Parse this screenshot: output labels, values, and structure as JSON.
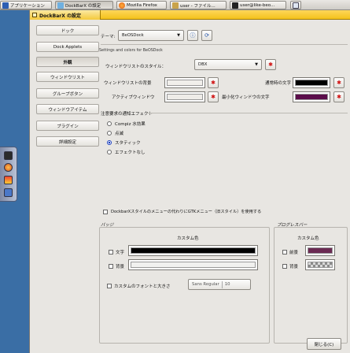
{
  "taskbar": {
    "items": [
      {
        "label": "アプリケーション",
        "icon": "apps-icon"
      },
      {
        "label": "DockBarX の設定",
        "icon": "dockbarx-icon"
      },
      {
        "label": "Mozilla Firefox",
        "icon": "firefox-icon"
      },
      {
        "label": "user - ファイル...",
        "icon": "folder-icon"
      },
      {
        "label": "user@like-beo...",
        "icon": "terminal-icon"
      }
    ]
  },
  "window": {
    "title": "DockBarX の設定"
  },
  "sidebar": {
    "items": [
      {
        "label": "ドック"
      },
      {
        "label": "Dock Applets"
      },
      {
        "label": "外観"
      },
      {
        "label": "ウィンドウリスト"
      },
      {
        "label": "グループボタン"
      },
      {
        "label": "ウィンドウアイテム"
      },
      {
        "label": "プラグイン"
      },
      {
        "label": "詳細設定"
      }
    ],
    "selected_index": 2
  },
  "appearance": {
    "theme_label": "テーマ:",
    "theme_value": "BeOSDock",
    "settings_heading": "Settings and colors for BeOSDock",
    "winlist_style_label": "ウィンドウリストのスタイル：",
    "winlist_style_value": "DBX",
    "winlist_bg_label": "ウィンドウリストの背景",
    "active_window_label": "アクティブウィンドウ",
    "normal_text_label": "通常時の文字",
    "minimized_text_label": "最小化ウィンドウの文字",
    "effect_heading": "注意要求の通知エフェクト",
    "effects": [
      {
        "label": "Compiz 水効果",
        "selected": false
      },
      {
        "label": "点滅",
        "selected": false
      },
      {
        "label": "スタティック",
        "selected": true
      },
      {
        "label": "エフェクトなし",
        "selected": false
      }
    ],
    "gtk_menu_label": "DockbarXスタイルのメニューの代わりにGTKメニュー（旧スタイル）を使用する",
    "gtk_menu_checked": false,
    "badge_heading": "バッジ",
    "badge_custom_color": "カスタム色",
    "badge_text_label": "文字",
    "badge_bg_label": "背景",
    "badge_font_label": "カスタムのフォントと大きさ",
    "badge_font_name": "Sans Regular",
    "badge_font_size": "10",
    "progress_heading": "プログレスバー",
    "progress_custom_color": "カスタム色",
    "progress_fg_label": "前景",
    "progress_bg_label": "背景",
    "close_button": "閉じる(C)"
  },
  "colors": {
    "winlist_bg": "#f1efeb",
    "active_window": "#eeece8",
    "normal_text": "#000000",
    "minimized_text": "#5b0d4a",
    "badge_text": "#000000",
    "badge_bg": "#f1f1ef",
    "progress_fg": "#6b2a52",
    "title_accent": "#f4c21c"
  }
}
